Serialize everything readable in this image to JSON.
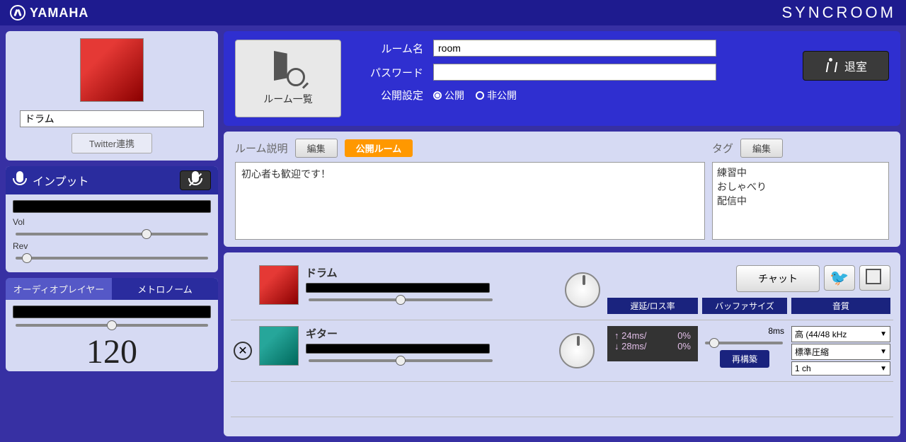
{
  "brand": {
    "left": "YAMAHA",
    "right": "SYNCROOM"
  },
  "sidebar": {
    "profile": {
      "name_value": "ドラム",
      "twitter_btn": "Twitter連携"
    },
    "input": {
      "title": "インプット",
      "vol_label": "Vol",
      "rev_label": "Rev"
    },
    "tabs": {
      "audio_player": "オーディオプレイヤー",
      "metronome": "メトロノーム"
    },
    "tempo": "120"
  },
  "room_setup": {
    "room_list_btn": "ルーム一覧",
    "room_name_label": "ルーム名",
    "room_name_value": "room",
    "password_label": "パスワード",
    "password_value": "",
    "visibility_label": "公開設定",
    "public_opt": "公開",
    "private_opt": "非公開",
    "leave_btn": "退室"
  },
  "desc": {
    "label": "ルーム説明",
    "edit_btn": "編集",
    "public_room_btn": "公開ルーム",
    "text": "初心者も歓迎です！",
    "tag_label": "タグ",
    "tag_edit_btn": "編集",
    "tags": [
      "練習中",
      "おしゃべり",
      "配信中"
    ]
  },
  "members": {
    "chat_btn": "チャット",
    "rows": [
      {
        "name": "ドラム"
      },
      {
        "name": "ギター"
      }
    ],
    "latency": {
      "header": "遅延/ロス率",
      "up_ms": "24ms/",
      "up_loss": "0%",
      "down_ms": "28ms/",
      "down_loss": "0%"
    },
    "buffer": {
      "header": "バッファサイズ",
      "value": "8ms",
      "rebuild": "再構築"
    },
    "quality": {
      "header": "音質",
      "rate": "高 (44/48 kHz",
      "compression": "標準圧縮",
      "channels": "1 ch"
    }
  }
}
